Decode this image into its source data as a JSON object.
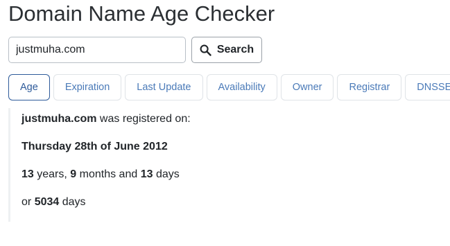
{
  "page": {
    "title": "Domain Name Age Checker"
  },
  "search": {
    "value": "justmuha.com",
    "button_label": "Search"
  },
  "tabs": [
    {
      "label": "Age",
      "active": true
    },
    {
      "label": "Expiration",
      "active": false
    },
    {
      "label": "Last Update",
      "active": false
    },
    {
      "label": "Availability",
      "active": false
    },
    {
      "label": "Owner",
      "active": false
    },
    {
      "label": "Registrar",
      "active": false
    },
    {
      "label": "DNSSEC",
      "active": false
    }
  ],
  "result": {
    "domain": "justmuha.com",
    "registered_text": "was registered on:",
    "date": "Thursday 28th of June 2012",
    "years": "13",
    "years_word": "years,",
    "months": "9",
    "months_word": "months and",
    "days": "13",
    "days_word": "days",
    "or_word": "or",
    "total_days": "5034",
    "total_days_word": "days"
  },
  "colors": {
    "accent": "#2e5b9a",
    "tab_text": "#4a7ab8",
    "text": "#212529"
  }
}
